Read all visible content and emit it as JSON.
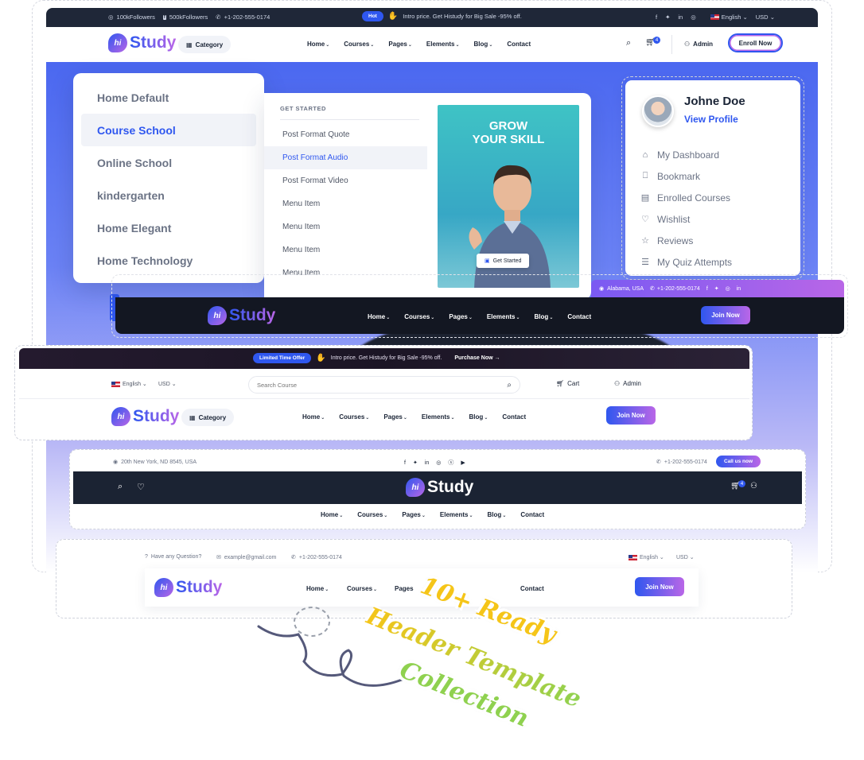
{
  "header1": {
    "topbar": {
      "followers_insta": "100kFollowers",
      "followers_fb": "500kFollowers",
      "phone": "+1-202-555-0174",
      "hot_badge": "Hot",
      "promo_text": "Intro price. Get Histudy for Big Sale -95% off.",
      "language": "English",
      "currency": "USD"
    },
    "logo_text": "Study",
    "logo_mark": "hi",
    "category": "Category",
    "nav": [
      "Home",
      "Courses",
      "Pages",
      "Elements",
      "Blog",
      "Contact"
    ],
    "cart_count": "4",
    "admin": "Admin",
    "cta": "Enroll Now"
  },
  "home_dropdown": {
    "items": [
      "Home Default",
      "Course School",
      "Online School",
      "kindergarten",
      "Home Elegant",
      "Home Technology"
    ],
    "active_index": 1
  },
  "pages_dropdown": {
    "heading": "GET STARTED",
    "items": [
      "Post Format Quote",
      "Post Format Audio",
      "Post Format Video",
      "Menu Item",
      "Menu Item",
      "Menu Item",
      "Menu Item"
    ],
    "active_index": 1,
    "promo_title_1": "GROW",
    "promo_title_2": "YOUR SKILL",
    "promo_button": "Get Started"
  },
  "profile": {
    "name": "Johne Doe",
    "link": "View Profile",
    "items": [
      "My Dashboard",
      "Bookmark",
      "Enrolled Courses",
      "Wishlist",
      "Reviews",
      "My Quiz Attempts"
    ]
  },
  "header2": {
    "address": "Alabama, USA",
    "phone": "+1-202-555-0174",
    "nav": [
      "Home",
      "Courses",
      "Pages",
      "Elements",
      "Blog",
      "Contact"
    ],
    "cta": "Join Now"
  },
  "header3": {
    "badge": "Limited Time Offer",
    "promo_text": "Intro price. Get Histudy for Big Sale -95% off.",
    "promo_link": "Purchase Now",
    "language": "English",
    "currency": "USD",
    "search_placeholder": "Search Course",
    "cart": "Cart",
    "admin": "Admin",
    "category": "Category",
    "nav": [
      "Home",
      "Courses",
      "Pages",
      "Elements",
      "Blog",
      "Contact"
    ],
    "cta": "Join Now"
  },
  "header4": {
    "address": "20th New York, ND 8545, USA",
    "phone": "+1-202-555-0174",
    "call_btn": "Call us now",
    "cart_count": "4",
    "nav": [
      "Home",
      "Courses",
      "Pages",
      "Elements",
      "Blog",
      "Contact"
    ]
  },
  "header5": {
    "question": "Have any Question?",
    "email": "example@gmail.com",
    "phone": "+1-202-555-0174",
    "language": "English",
    "currency": "USD",
    "nav": [
      "Home",
      "Courses",
      "Pages",
      "Contact"
    ],
    "cta": "Join Now"
  },
  "tagline": {
    "line1": "10+ Ready",
    "line2": "Header Template",
    "line3": "Collection"
  },
  "colors": {
    "primary": "#2f57ef",
    "secondary": "#b966e7",
    "dark": "#192335",
    "handwriting_yellow": "#f5c518",
    "handwriting_green": "#8fd14f"
  }
}
